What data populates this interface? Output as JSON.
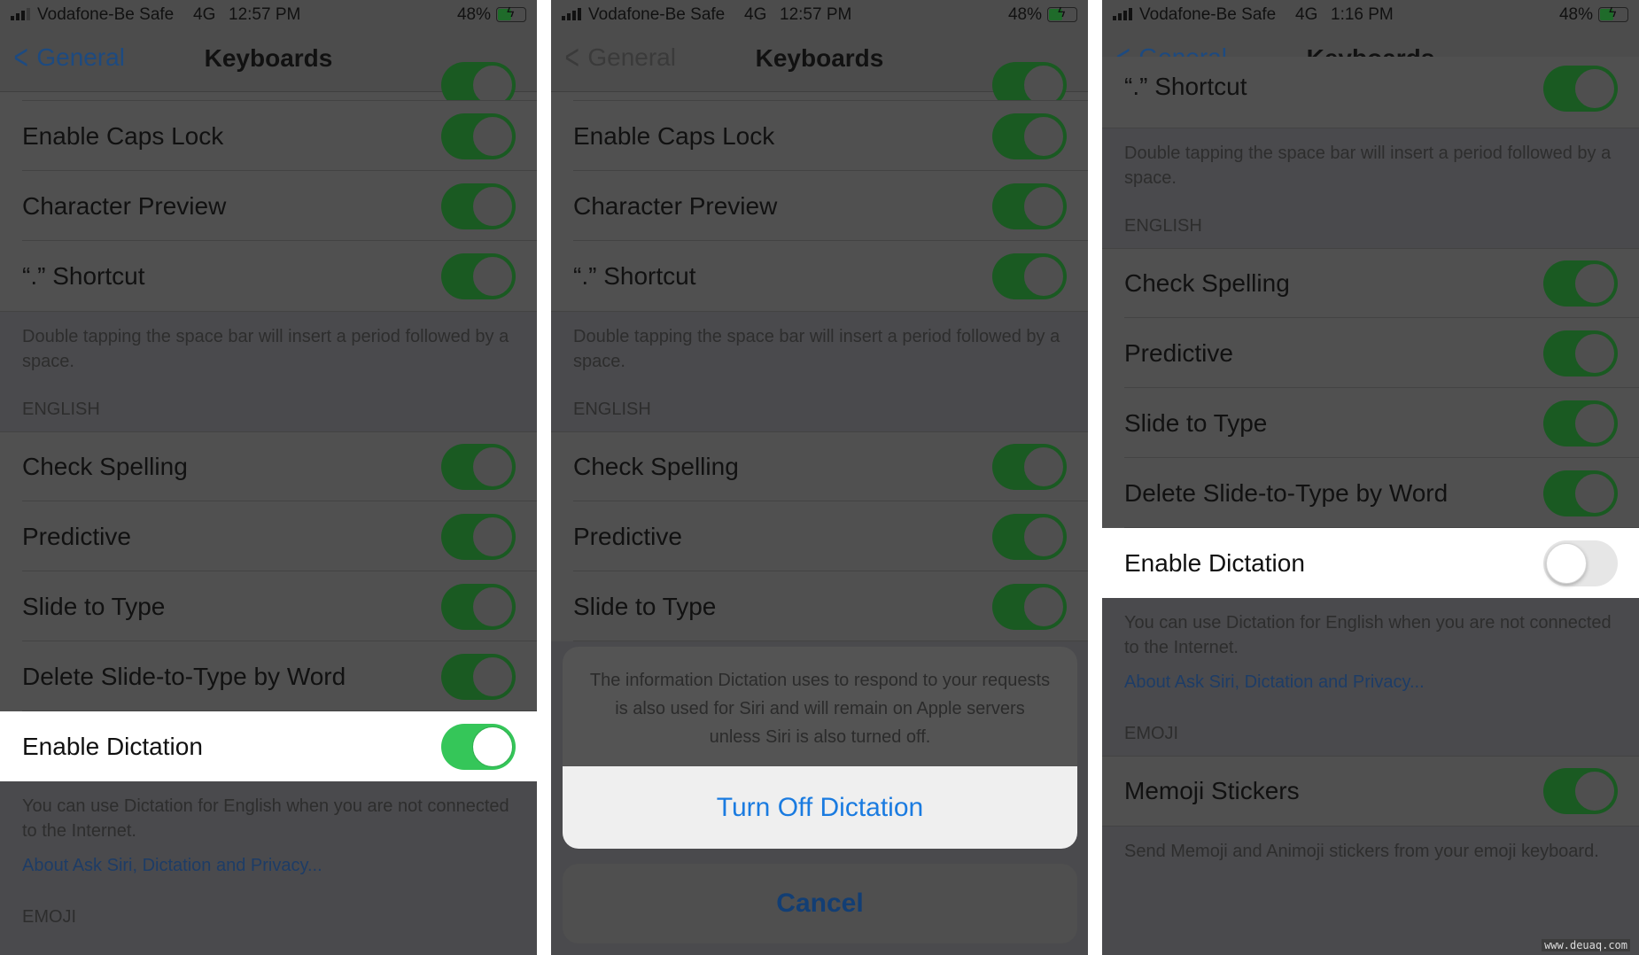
{
  "status_bar": [
    {
      "carrier": "Vodafone-Be Safe",
      "network": "4G",
      "time": "12:57 PM",
      "battery": "48%"
    },
    {
      "carrier": "Vodafone-Be Safe",
      "network": "4G",
      "time": "12:57 PM",
      "battery": "48%"
    },
    {
      "carrier": "Vodafone-Be Safe",
      "network": "4G",
      "time": "1:16 PM",
      "battery": "48%"
    }
  ],
  "nav": {
    "back_label": "General",
    "title": "Keyboards"
  },
  "rows": {
    "caps_lock": "Enable Caps Lock",
    "char_preview": "Character Preview",
    "shortcut": "“.” Shortcut",
    "check_spelling": "Check Spelling",
    "predictive": "Predictive",
    "slide_to_type": "Slide to Type",
    "delete_slide": "Delete Slide-to-Type by Word",
    "enable_dictation": "Enable Dictation",
    "memoji": "Memoji Stickers"
  },
  "toggles": {
    "panel1_enable_dictation": "on",
    "panel3_enable_dictation": "off",
    "others": "on"
  },
  "footers": {
    "shortcut": "Double tapping the space bar will insert a period followed by a space.",
    "dictation": "You can use Dictation for English when you are not connected to the Internet.",
    "memoji": "Send Memoji and Animoji stickers from your emoji keyboard."
  },
  "sections": {
    "english": "ENGLISH",
    "emoji": "EMOJI"
  },
  "link": "About Ask Siri, Dictation and Privacy...",
  "action_sheet": {
    "message": "The information Dictation uses to respond to your requests is also used for Siri and will remain on Apple servers unless Siri is also turned off.",
    "confirm": "Turn Off Dictation",
    "cancel": "Cancel"
  },
  "watermark": "www.deuaq.com",
  "colors": {
    "toggle_on": "#35c659",
    "link_blue": "#1a7be0",
    "dimmed_overlay": "#4a4a4d"
  }
}
